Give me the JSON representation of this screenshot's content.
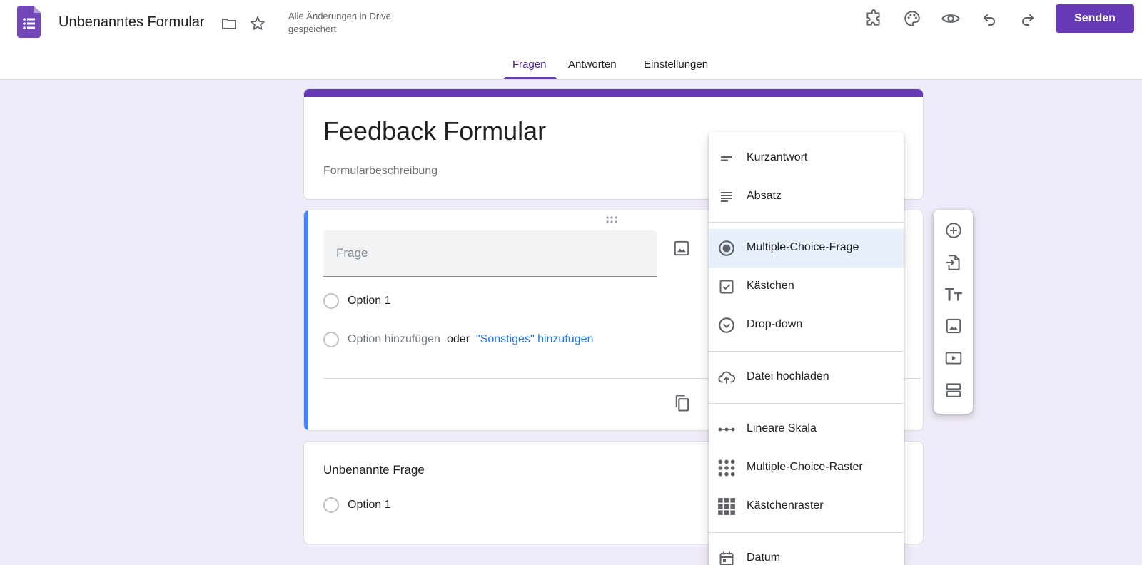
{
  "header": {
    "doc_title": "Unbenanntes Formular",
    "save_status": "Alle Änderungen in Drive gespeichert",
    "send_label": "Senden",
    "icons": [
      "folder-icon",
      "star-icon",
      "addon-icon",
      "palette-icon",
      "preview-icon",
      "undo-icon",
      "redo-icon"
    ]
  },
  "tabs": [
    {
      "label": "Fragen",
      "active": true
    },
    {
      "label": "Antworten",
      "active": false
    },
    {
      "label": "Einstellungen",
      "active": false
    }
  ],
  "form": {
    "title": "Feedback Formular",
    "description_placeholder": "Formularbeschreibung"
  },
  "question1": {
    "placeholder": "Frage",
    "option1": "Option 1",
    "add_option": "Option hinzufügen",
    "or": "oder",
    "add_other": "\"Sonstiges\" hinzufügen"
  },
  "question2": {
    "title": "Unbenannte Frage",
    "option1": "Option 1"
  },
  "type_menu": {
    "items": [
      {
        "label": "Kurzantwort",
        "icon": "short-answer-icon"
      },
      {
        "label": "Absatz",
        "icon": "paragraph-icon"
      },
      {
        "label": "Multiple-Choice-Frage",
        "icon": "radio-icon",
        "selected": true
      },
      {
        "label": "Kästchen",
        "icon": "checkbox-icon"
      },
      {
        "label": "Drop-down",
        "icon": "dropdown-icon"
      },
      {
        "label": "Datei hochladen",
        "icon": "upload-cloud-icon"
      },
      {
        "label": "Lineare Skala",
        "icon": "linear-scale-icon"
      },
      {
        "label": "Multiple-Choice-Raster",
        "icon": "mc-grid-icon"
      },
      {
        "label": "Kästchenraster",
        "icon": "checkbox-grid-icon"
      },
      {
        "label": "Datum",
        "icon": "calendar-icon"
      }
    ]
  },
  "side_toolbar": [
    "add-question-icon",
    "import-questions-icon",
    "add-title-icon",
    "add-image-icon",
    "add-video-icon",
    "add-section-icon"
  ],
  "colors": {
    "accent": "#673ab7",
    "active_question": "#4285f4",
    "link": "#1a73e8",
    "background": "#f0ebf8"
  }
}
